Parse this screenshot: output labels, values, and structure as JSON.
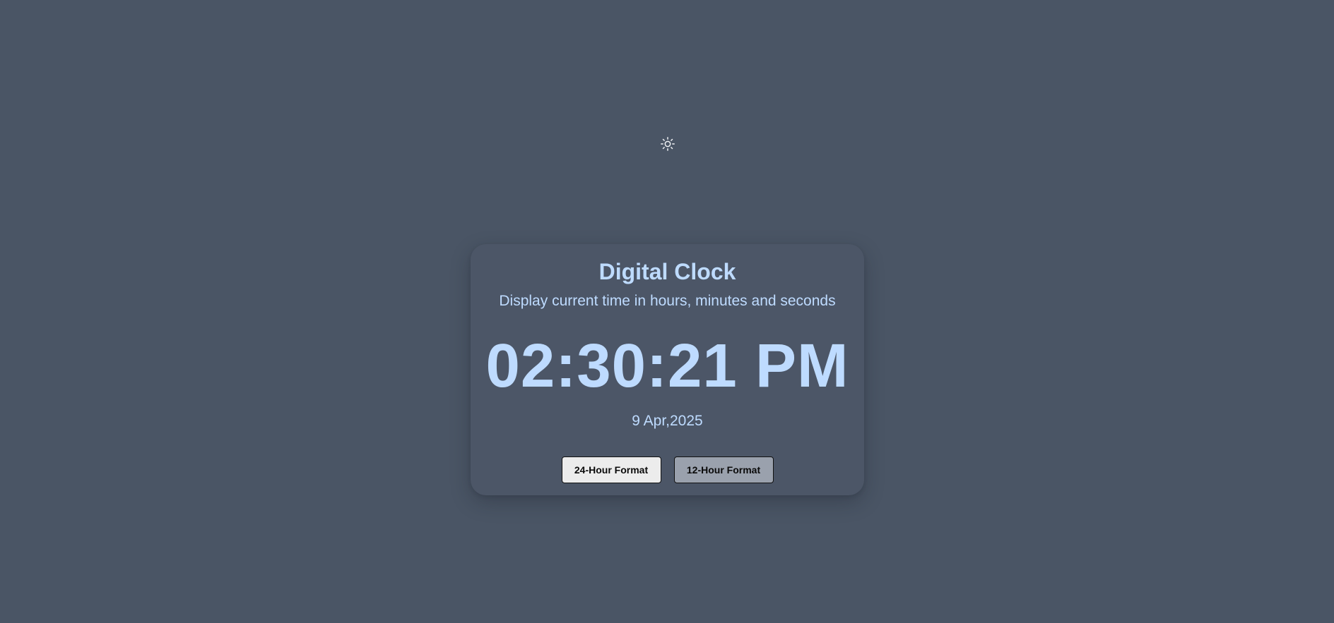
{
  "theme_toggle": {
    "icon": "sun-icon"
  },
  "clock": {
    "title": "Digital Clock",
    "subtitle": "Display current time in hours, minutes and seconds",
    "time": "02:30:21 PM",
    "date": "9 Apr,2025"
  },
  "buttons": {
    "format_24_label": "24-Hour Format",
    "format_12_label": "12-Hour Format"
  },
  "colors": {
    "background": "#4a5565",
    "card": "#4c5667",
    "accent_text": "#bedbff",
    "button_light": "#ececec",
    "button_muted": "#9aa1ad"
  }
}
